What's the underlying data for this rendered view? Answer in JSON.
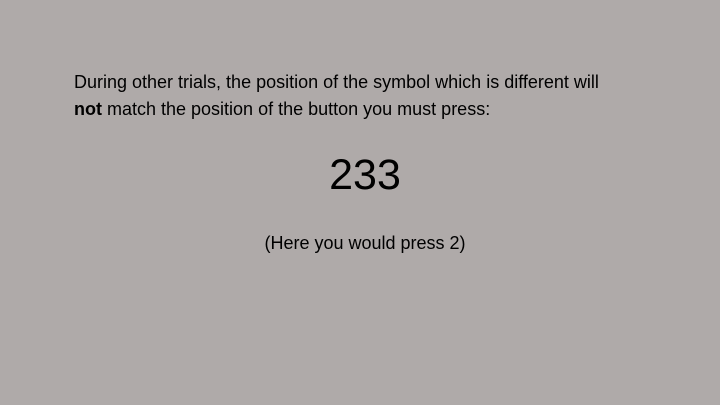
{
  "slide": {
    "background_color": "#afaaa9",
    "instruction": {
      "line1": "During other trials, the position of the symbol which is different will",
      "line2_bold": "not",
      "line2_rest": " match the position of the button you must press:"
    },
    "stimulus": "233",
    "hint": "(Here you would press 2)"
  }
}
